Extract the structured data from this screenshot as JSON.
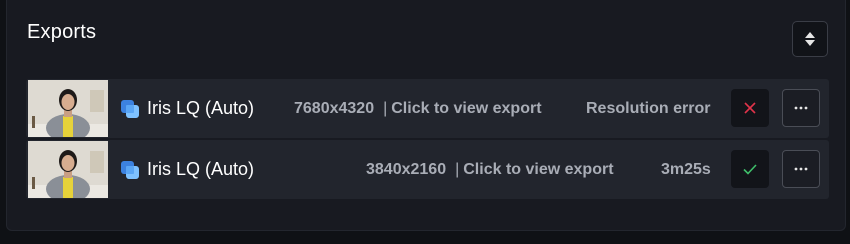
{
  "header": {
    "title": "Exports",
    "sort_icon": "sort-updown-icon"
  },
  "exports": [
    {
      "name": "Iris LQ (Auto)",
      "resolution": "7680x4320",
      "separator": "|",
      "view_link": "Click to view export",
      "status_text": "Resolution error",
      "status_icon": "close-icon",
      "status_color": "#e0344a",
      "more_icon": "more-horizontal-icon"
    },
    {
      "name": "Iris LQ (Auto)",
      "resolution": "3840x2160",
      "separator": "|",
      "view_link": "Click to view export",
      "status_text": "3m25s",
      "status_icon": "check-icon",
      "status_color": "#3fbf6a",
      "more_icon": "more-horizontal-icon"
    }
  ]
}
